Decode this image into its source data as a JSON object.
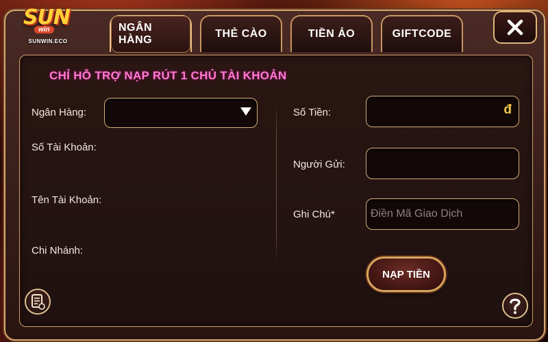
{
  "logo": {
    "main": "SUN",
    "sub": "win",
    "domain": "SUNWIN.ECO"
  },
  "tabs": [
    {
      "label": "NGÂN HÀNG",
      "active": true
    },
    {
      "label": "THẺ CÀO",
      "active": false
    },
    {
      "label": "TIỀN ẢO",
      "active": false
    },
    {
      "label": "GIFTCODE",
      "active": false
    }
  ],
  "notice": "CHỈ HỖ TRỢ NẠP RÚT 1 CHỦ TÀI KHOẢN",
  "left_form": {
    "bank_label": "Ngân Hàng:",
    "bank_value": "",
    "account_number_label": "Số Tài Khoản:",
    "account_name_label": "Tên Tài Khoản:",
    "branch_label": "Chi Nhánh:"
  },
  "right_form": {
    "amount_label": "Số Tiền:",
    "amount_value": "",
    "currency_symbol": "đ",
    "sender_label": "Người Gửi:",
    "sender_value": "",
    "note_label": "Ghi Chú*",
    "note_placeholder": "Điền Mã Giao Dịch"
  },
  "submit_label": "NẠP TIỀN",
  "icons": {
    "close": "close-icon",
    "history": "history-icon",
    "help": "help-icon"
  },
  "colors": {
    "accent_gold": "#d9b07a",
    "notice_pink": "#ff7ad0",
    "currency_gold": "#f2c84a"
  }
}
